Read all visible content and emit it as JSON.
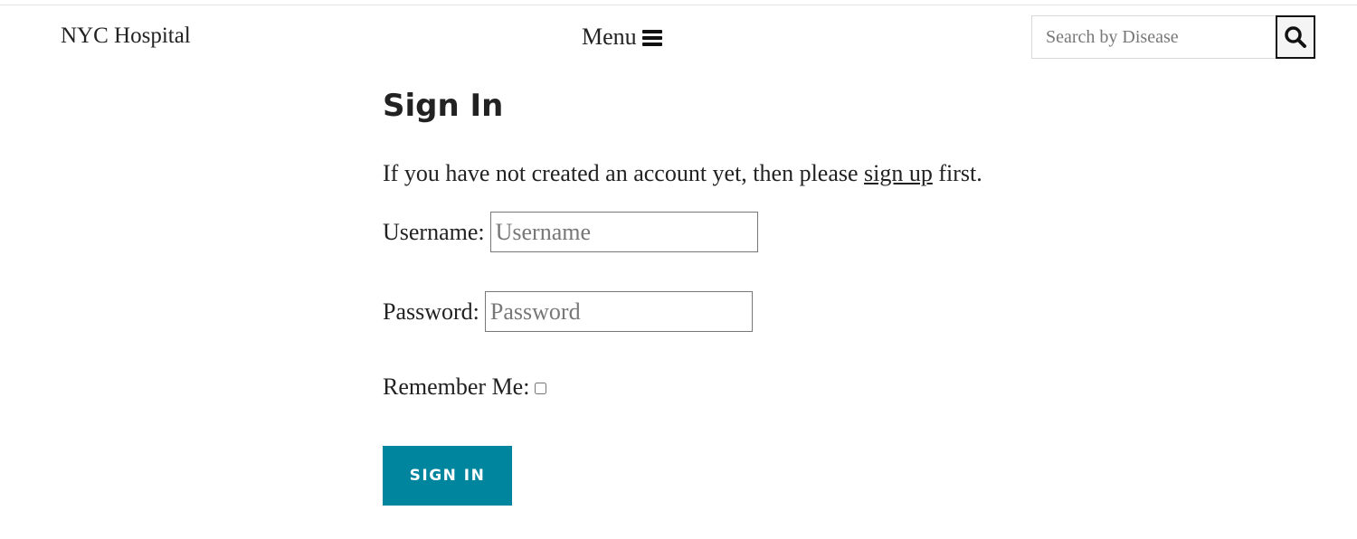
{
  "header": {
    "brand": "NYC Hospital",
    "menu_label": "Menu",
    "menu_icon": "hamburger-icon",
    "search": {
      "placeholder": "Search by Disease",
      "value": "",
      "button_icon": "search-icon"
    }
  },
  "main": {
    "title": "Sign In",
    "intro_before": "If you have not created an account yet, then please ",
    "intro_link": "sign up",
    "intro_after": " first.",
    "username_label": "Username:",
    "username_placeholder": "Username",
    "password_label": "Password:",
    "password_placeholder": "Password",
    "remember_label": "Remember Me:",
    "remember_checked": false,
    "submit_label": "SIGN IN"
  },
  "colors": {
    "accent": "#00859e",
    "text": "#222222",
    "border": "#d8d8d8"
  }
}
